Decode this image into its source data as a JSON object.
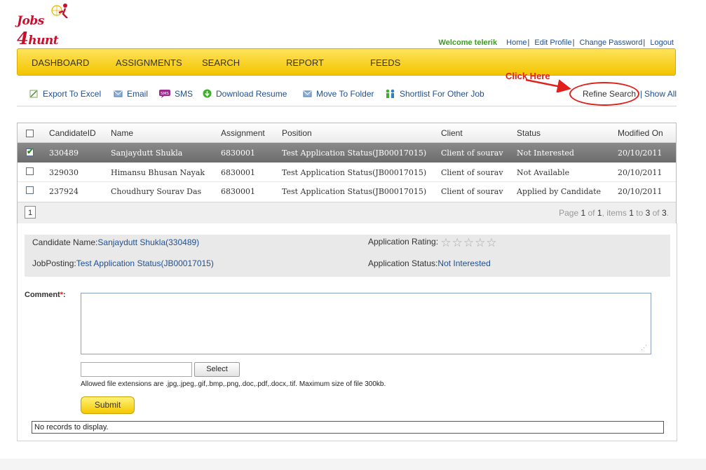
{
  "logo": {
    "line1": "Jobs",
    "line2a": "4",
    "line2b": "hunt"
  },
  "topnav": {
    "welcome": "Welcome telerik",
    "links": [
      "Home",
      "Edit Profile",
      "Change Password",
      "Logout"
    ]
  },
  "menu": [
    "DASHBOARD",
    "ASSIGNMENTS",
    "SEARCH",
    "REPORT",
    "FEEDS"
  ],
  "callout": "Click Here",
  "toolbar": {
    "export": "Export To Excel",
    "email": "Email",
    "sms": "SMS",
    "download": "Download Resume",
    "move": "Move To Folder",
    "shortlist": "Shortlist For Other Job",
    "refine": "Refine Search",
    "sep": "|",
    "show_all": "Show All"
  },
  "grid": {
    "headers": [
      "CandidateID",
      "Name",
      "Assignment",
      "Position",
      "Client",
      "Status",
      "Modified On"
    ],
    "rows": [
      [
        "330489",
        "Sanjaydutt Shukla",
        "6830001",
        "Test Application Status(JB00017015)",
        "Client of sourav",
        "Not Interested",
        "20/10/2011"
      ],
      [
        "329030",
        "Himansu Bhusan Nayak",
        "6830001",
        "Test Application Status(JB00017015)",
        "Client of sourav",
        "Not Available",
        "20/10/2011"
      ],
      [
        "237924",
        "Choudhury Sourav Das",
        "6830001",
        "Test Application Status(JB00017015)",
        "Client of sourav",
        "Applied by Candidate",
        "20/10/2011"
      ]
    ],
    "selected_row": 0,
    "page_button": "1",
    "page_info": {
      "p1": "Page ",
      "cur": "1",
      "p2": " of ",
      "tot": "1",
      "p3": ", items ",
      "from": "1",
      "p4": " to ",
      "to": "3",
      "p5": " of ",
      "count": "3",
      "p6": "."
    }
  },
  "detail": {
    "candidate_label": "Candidate Name:",
    "candidate_value": "Sanjaydutt Shukla(330489)",
    "rating_label": "Application Rating:",
    "rating": 0,
    "rating_max": 5,
    "posting_label": "JobPosting:",
    "posting_value": "Test Application Status(JB00017015)",
    "status_label": "Application Status:",
    "status_value": "Not Interested",
    "comment_label": "Comment",
    "comment_req": "*",
    "comment_colon": ":",
    "comment_value": "",
    "select_button": "Select",
    "allowed_text": "Allowed file extensions are .jpg,.jpeg,.gif,.bmp,.png,.doc,.pdf,.docx,.tif. Maximum size of file 300kb.",
    "submit_button": "Submit",
    "no_records": "No records to display."
  },
  "colors": {
    "menu_yellow": "#f7d21c",
    "accent_red": "#e0201b",
    "link_blue": "#1f4f8f",
    "welcome_green": "#3b9b22"
  }
}
